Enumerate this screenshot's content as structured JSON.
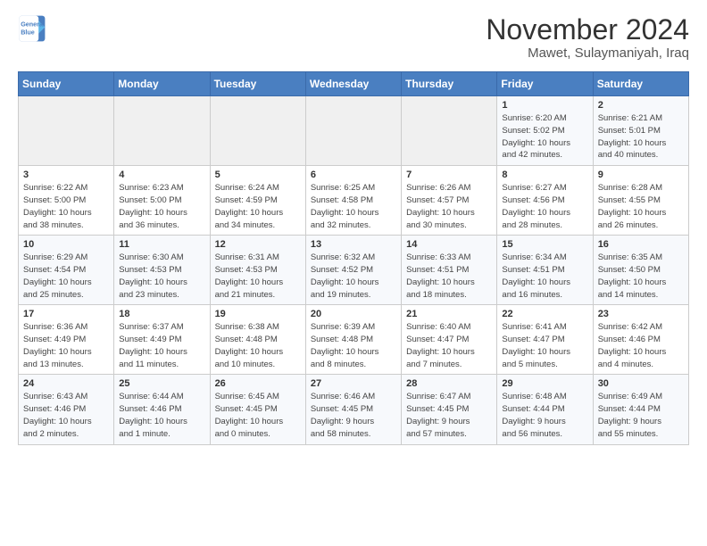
{
  "logo": {
    "line1": "General",
    "line2": "Blue"
  },
  "title": "November 2024",
  "location": "Mawet, Sulaymaniyah, Iraq",
  "days_of_week": [
    "Sunday",
    "Monday",
    "Tuesday",
    "Wednesday",
    "Thursday",
    "Friday",
    "Saturday"
  ],
  "weeks": [
    [
      {
        "day": "",
        "info": ""
      },
      {
        "day": "",
        "info": ""
      },
      {
        "day": "",
        "info": ""
      },
      {
        "day": "",
        "info": ""
      },
      {
        "day": "",
        "info": ""
      },
      {
        "day": "1",
        "info": "Sunrise: 6:20 AM\nSunset: 5:02 PM\nDaylight: 10 hours\nand 42 minutes."
      },
      {
        "day": "2",
        "info": "Sunrise: 6:21 AM\nSunset: 5:01 PM\nDaylight: 10 hours\nand 40 minutes."
      }
    ],
    [
      {
        "day": "3",
        "info": "Sunrise: 6:22 AM\nSunset: 5:00 PM\nDaylight: 10 hours\nand 38 minutes."
      },
      {
        "day": "4",
        "info": "Sunrise: 6:23 AM\nSunset: 5:00 PM\nDaylight: 10 hours\nand 36 minutes."
      },
      {
        "day": "5",
        "info": "Sunrise: 6:24 AM\nSunset: 4:59 PM\nDaylight: 10 hours\nand 34 minutes."
      },
      {
        "day": "6",
        "info": "Sunrise: 6:25 AM\nSunset: 4:58 PM\nDaylight: 10 hours\nand 32 minutes."
      },
      {
        "day": "7",
        "info": "Sunrise: 6:26 AM\nSunset: 4:57 PM\nDaylight: 10 hours\nand 30 minutes."
      },
      {
        "day": "8",
        "info": "Sunrise: 6:27 AM\nSunset: 4:56 PM\nDaylight: 10 hours\nand 28 minutes."
      },
      {
        "day": "9",
        "info": "Sunrise: 6:28 AM\nSunset: 4:55 PM\nDaylight: 10 hours\nand 26 minutes."
      }
    ],
    [
      {
        "day": "10",
        "info": "Sunrise: 6:29 AM\nSunset: 4:54 PM\nDaylight: 10 hours\nand 25 minutes."
      },
      {
        "day": "11",
        "info": "Sunrise: 6:30 AM\nSunset: 4:53 PM\nDaylight: 10 hours\nand 23 minutes."
      },
      {
        "day": "12",
        "info": "Sunrise: 6:31 AM\nSunset: 4:53 PM\nDaylight: 10 hours\nand 21 minutes."
      },
      {
        "day": "13",
        "info": "Sunrise: 6:32 AM\nSunset: 4:52 PM\nDaylight: 10 hours\nand 19 minutes."
      },
      {
        "day": "14",
        "info": "Sunrise: 6:33 AM\nSunset: 4:51 PM\nDaylight: 10 hours\nand 18 minutes."
      },
      {
        "day": "15",
        "info": "Sunrise: 6:34 AM\nSunset: 4:51 PM\nDaylight: 10 hours\nand 16 minutes."
      },
      {
        "day": "16",
        "info": "Sunrise: 6:35 AM\nSunset: 4:50 PM\nDaylight: 10 hours\nand 14 minutes."
      }
    ],
    [
      {
        "day": "17",
        "info": "Sunrise: 6:36 AM\nSunset: 4:49 PM\nDaylight: 10 hours\nand 13 minutes."
      },
      {
        "day": "18",
        "info": "Sunrise: 6:37 AM\nSunset: 4:49 PM\nDaylight: 10 hours\nand 11 minutes."
      },
      {
        "day": "19",
        "info": "Sunrise: 6:38 AM\nSunset: 4:48 PM\nDaylight: 10 hours\nand 10 minutes."
      },
      {
        "day": "20",
        "info": "Sunrise: 6:39 AM\nSunset: 4:48 PM\nDaylight: 10 hours\nand 8 minutes."
      },
      {
        "day": "21",
        "info": "Sunrise: 6:40 AM\nSunset: 4:47 PM\nDaylight: 10 hours\nand 7 minutes."
      },
      {
        "day": "22",
        "info": "Sunrise: 6:41 AM\nSunset: 4:47 PM\nDaylight: 10 hours\nand 5 minutes."
      },
      {
        "day": "23",
        "info": "Sunrise: 6:42 AM\nSunset: 4:46 PM\nDaylight: 10 hours\nand 4 minutes."
      }
    ],
    [
      {
        "day": "24",
        "info": "Sunrise: 6:43 AM\nSunset: 4:46 PM\nDaylight: 10 hours\nand 2 minutes."
      },
      {
        "day": "25",
        "info": "Sunrise: 6:44 AM\nSunset: 4:46 PM\nDaylight: 10 hours\nand 1 minute."
      },
      {
        "day": "26",
        "info": "Sunrise: 6:45 AM\nSunset: 4:45 PM\nDaylight: 10 hours\nand 0 minutes."
      },
      {
        "day": "27",
        "info": "Sunrise: 6:46 AM\nSunset: 4:45 PM\nDaylight: 9 hours\nand 58 minutes."
      },
      {
        "day": "28",
        "info": "Sunrise: 6:47 AM\nSunset: 4:45 PM\nDaylight: 9 hours\nand 57 minutes."
      },
      {
        "day": "29",
        "info": "Sunrise: 6:48 AM\nSunset: 4:44 PM\nDaylight: 9 hours\nand 56 minutes."
      },
      {
        "day": "30",
        "info": "Sunrise: 6:49 AM\nSunset: 4:44 PM\nDaylight: 9 hours\nand 55 minutes."
      }
    ]
  ]
}
